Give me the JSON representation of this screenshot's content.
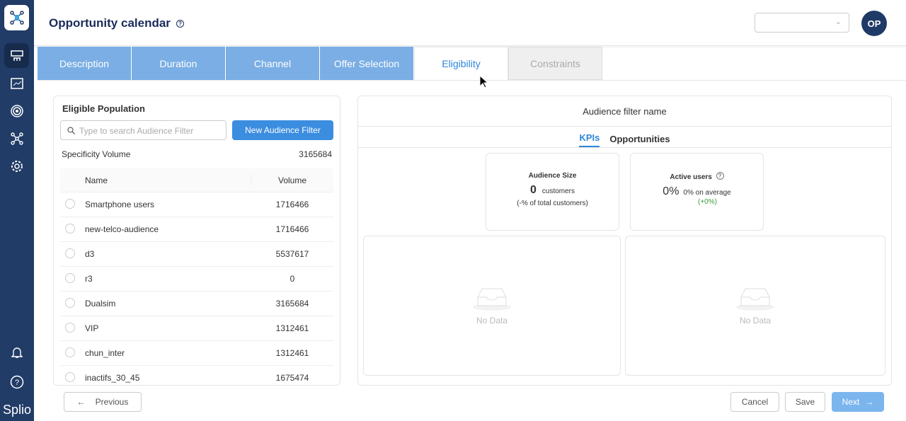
{
  "sidebar": {
    "brand": "Splio",
    "items": [
      "campaigns",
      "dashboard",
      "targets",
      "network",
      "settings"
    ],
    "bottom": [
      "notifications",
      "help"
    ]
  },
  "header": {
    "title": "Opportunity calendar",
    "help": "?",
    "avatar": "OP",
    "select_value": ""
  },
  "tabs": [
    {
      "label": "Description"
    },
    {
      "label": "Duration"
    },
    {
      "label": "Channel"
    },
    {
      "label": "Offer Selection"
    },
    {
      "label": "Eligibility"
    },
    {
      "label": "Constraints"
    }
  ],
  "left": {
    "title": "Eligible Population",
    "search_placeholder": "Type to search Audience Filter",
    "new_button": "New Audience Filter",
    "spec_label": "Specificity Volume",
    "spec_value": "3165684",
    "columns": [
      "Name",
      "Volume"
    ],
    "rows": [
      {
        "name": "Smartphone users",
        "volume": "1716466"
      },
      {
        "name": "new-telco-audience",
        "volume": "1716466"
      },
      {
        "name": "d3",
        "volume": "5537617"
      },
      {
        "name": "r3",
        "volume": "0"
      },
      {
        "name": "Dualsim",
        "volume": "3165684"
      },
      {
        "name": "VIP",
        "volume": "1312461"
      },
      {
        "name": "chun_inter",
        "volume": "1312461"
      },
      {
        "name": "inactifs_30_45",
        "volume": "1675474"
      }
    ]
  },
  "right": {
    "title": "Audience filter name",
    "subtabs": [
      "KPIs",
      "Opportunities"
    ],
    "audience": {
      "title": "Audience Size",
      "value": "0",
      "unit": "customers",
      "note": "(-% of total customers)"
    },
    "active": {
      "title": "Active users",
      "help": "?",
      "value": "0%",
      "avg": "0% on average",
      "delta": "(+0%)"
    },
    "no_data": "No Data"
  },
  "footer": {
    "previous": "Previous",
    "cancel": "Cancel",
    "save": "Save",
    "next": "Next"
  },
  "colors": {
    "sidebar": "#213c66",
    "tab": "#7aaee4",
    "accent": "#2f86dc",
    "positive": "#3a9a3a"
  }
}
